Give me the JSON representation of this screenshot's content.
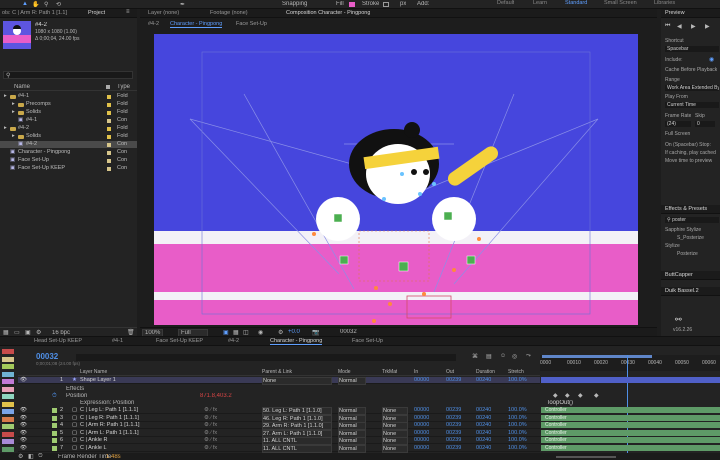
{
  "menubar": {
    "snapping": "Snapping",
    "fill": "Fill",
    "stroke": "Stroke",
    "px_value": "px",
    "add": "Add:",
    "workspaces": [
      "Default",
      "Learn",
      "Standard",
      "Small Screen",
      "Libraries"
    ],
    "active_workspace": "Standard"
  },
  "project": {
    "header_title": "ols: C | Arm R: Path 1 [1.1]",
    "tab": "Project",
    "selected_name": "#4-2",
    "selected_info1": "1080 x 1080 (1.00)",
    "selected_info2": "Δ 0;00;04, 24.00 fps",
    "col_name": "Name",
    "col_type": "Type",
    "rows": [
      {
        "name": "#4-1",
        "type": "Fold",
        "indent": 0,
        "kind": "folder",
        "color": "#e0c14a"
      },
      {
        "name": "Precomps",
        "type": "Fold",
        "indent": 1,
        "kind": "folder",
        "color": "#e0c14a"
      },
      {
        "name": "Solids",
        "type": "Fold",
        "indent": 1,
        "kind": "folder",
        "color": "#e0c14a"
      },
      {
        "name": "#4-1",
        "type": "Con",
        "indent": 1,
        "kind": "comp",
        "color": "#d6c58a"
      },
      {
        "name": "#4-2",
        "type": "Fold",
        "indent": 0,
        "kind": "folder",
        "color": "#e0c14a"
      },
      {
        "name": "Solids",
        "type": "Fold",
        "indent": 1,
        "kind": "folder",
        "color": "#e0c14a"
      },
      {
        "name": "#4-2",
        "type": "Con",
        "indent": 1,
        "kind": "comp",
        "color": "#d6c58a",
        "selected": true
      },
      {
        "name": "Character - Pingpong",
        "type": "Con",
        "indent": 0,
        "kind": "comp",
        "color": "#d6c58a"
      },
      {
        "name": "Face Set-Up",
        "type": "Con",
        "indent": 0,
        "kind": "comp",
        "color": "#d6c58a"
      },
      {
        "name": "Face Set-Up KEEP",
        "type": "Con",
        "indent": 0,
        "kind": "comp",
        "color": "#d6c58a"
      }
    ],
    "bpc": "16 bpc"
  },
  "viewer": {
    "tab_layer": "Layer (none)",
    "tab_footage": "Footage (none)",
    "tab_comp": "Composition Character - Pingpong",
    "crumbs": [
      "#4-2",
      "Character - Pingpong",
      "Face Set-Up"
    ],
    "zoom": "100%",
    "resolution": "Full",
    "exposure": "+0.0",
    "timecode": "00032"
  },
  "preview": {
    "title": "Preview",
    "shortcut_label": "Shortcut",
    "shortcut_value": "Spacebar",
    "include_label": "Include:",
    "cache_label": "Cache Before Playback",
    "range_label": "Range",
    "range_value": "Work Area Extended By",
    "playfrom_label": "Play From",
    "playfrom_value": "Current Time",
    "framerate_label": "Frame Rate",
    "skip_label": "Skip",
    "framerate_value": "(24)",
    "skip_value": "0",
    "fullscreen_label": "Full Screen",
    "stop_label": "On (Spacebar) Stop:",
    "ifcaching_label": "If caching, play cached",
    "movetime_label": "Move time to preview",
    "effects_title": "Effects & Presets",
    "effects_search": "poster",
    "sapphire": "Sapphire Stylize",
    "s_posterize": "S_Posterize",
    "stylize": "Stylize",
    "posterize": "Posterize",
    "buttcapper": "ButtCapper",
    "duik": "Duik Bassel.2",
    "duik_version": "v16.2.26"
  },
  "timeline": {
    "tabs": [
      "Head Set-Up KEEP",
      "#4-1",
      "Face Set-Up KEEP",
      "#4-2",
      "Character - Pingpong",
      "Face Set-Up"
    ],
    "active_tab": "Character - Pingpong",
    "timecode": "00032",
    "time_sub": "0;00;01;08 (24.00 fps)",
    "headers": {
      "layer_name": "Layer Name",
      "parent": "Parent & Link",
      "mode": "Mode",
      "trkmat": "TrkMat",
      "in": "In",
      "out": "Out",
      "duration": "Duration",
      "stretch": "Stretch"
    },
    "ruler": [
      "0000",
      "00010",
      "00020",
      "00030",
      "00040",
      "00050",
      "00060"
    ],
    "shape_layer": {
      "num": "1",
      "name": "Shape Layer 1",
      "parent": "None",
      "mode": "Normal",
      "in": "00000",
      "out": "00239",
      "dur": "00240",
      "stretch": "100.0%"
    },
    "effects_label": "Effects",
    "position_label": "Position",
    "position_value": "871.8,403.2",
    "expression_label": "Expression: Position",
    "expression_text": "loopOut()",
    "layers": [
      {
        "num": "2",
        "name": "C | Leg L: Path 1 [1.1.1]",
        "parent": "50. Leg L: Path 1 [1.1.0]",
        "mode": "Normal",
        "trk": "None",
        "in": "00000",
        "out": "00239",
        "dur": "00240",
        "stretch": "100.0%",
        "color": "#9fcb71"
      },
      {
        "num": "3",
        "name": "C | Leg R: Path 1 [1.1.1]",
        "parent": "46. Leg R: Path 1 [1.1.0]",
        "mode": "Normal",
        "trk": "None",
        "in": "00000",
        "out": "00239",
        "dur": "00240",
        "stretch": "100.0%",
        "color": "#9fcb71"
      },
      {
        "num": "4",
        "name": "C | Arm R: Path 1 [1.1.1]",
        "parent": "29. Arm R: Path 1 [1.1.0]",
        "mode": "Normal",
        "trk": "None",
        "in": "00000",
        "out": "00239",
        "dur": "00240",
        "stretch": "100.0%",
        "color": "#9fcb71"
      },
      {
        "num": "5",
        "name": "C | Arm L: Path 1 [1.1.1]",
        "parent": "27. Arm L: Path 1 [1.1.0]",
        "mode": "Normal",
        "trk": "None",
        "in": "00000",
        "out": "00239",
        "dur": "00240",
        "stretch": "100.0%",
        "color": "#9fcb71"
      },
      {
        "num": "6",
        "name": "C | Ankle R",
        "parent": "11. ALL CNTL",
        "mode": "Normal",
        "trk": "None",
        "in": "00000",
        "out": "00239",
        "dur": "00240",
        "stretch": "100.0%",
        "color": "#9fcb71"
      },
      {
        "num": "7",
        "name": "C | Ankle L",
        "parent": "11. ALL CNTL",
        "mode": "Normal",
        "trk": "None",
        "in": "00000",
        "out": "00239",
        "dur": "00240",
        "stretch": "100.0%",
        "color": "#9fcb71"
      }
    ],
    "controller_label": "Controller",
    "frame_render": "Frame Render Time",
    "frame_render_value": "1.48s"
  },
  "colors": {
    "comp_bg": "#4646dd",
    "pink": "#e85dc8",
    "white_stripe": "#f3f1f7",
    "accent": "#2d8ceb",
    "track": "#5e9a67",
    "yellow": "#f5d23b"
  }
}
